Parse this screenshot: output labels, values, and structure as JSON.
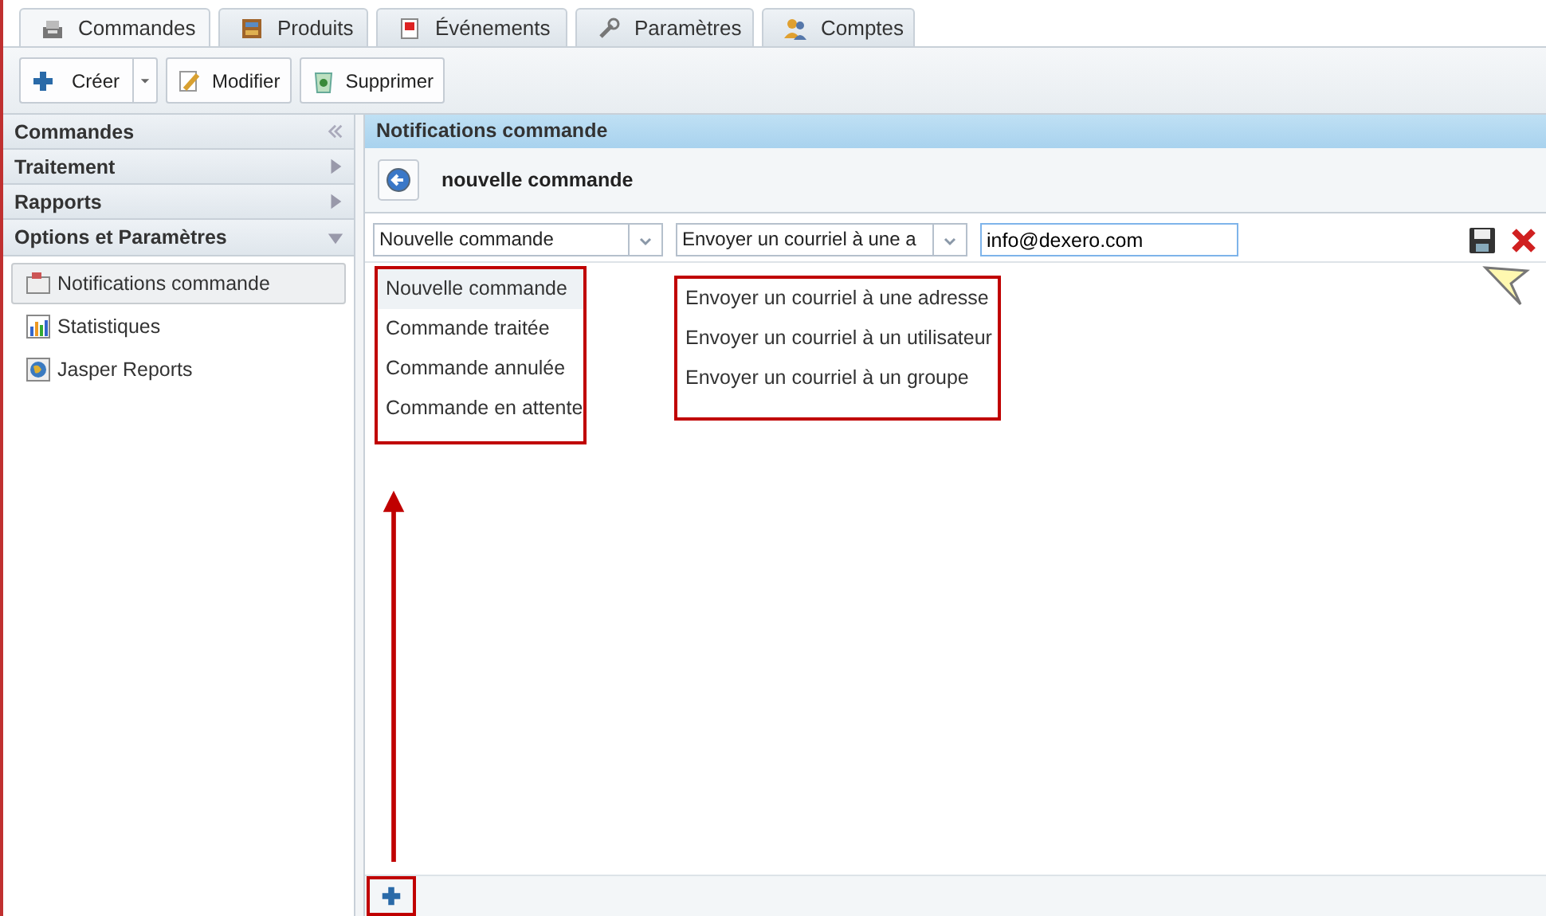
{
  "tabs": [
    {
      "label": "Commandes",
      "selected": true
    },
    {
      "label": "Produits",
      "selected": false
    },
    {
      "label": "Événements",
      "selected": false
    },
    {
      "label": "Paramètres",
      "selected": false
    },
    {
      "label": "Comptes",
      "selected": false
    }
  ],
  "toolbar": [
    {
      "label": "Créer",
      "kind": "split"
    },
    {
      "label": "Modifier",
      "kind": "plain"
    },
    {
      "label": "Supprimer",
      "kind": "plain"
    }
  ],
  "sidebar": {
    "sections": [
      {
        "title": "Commandes",
        "kind": "collapse"
      },
      {
        "title": "Traitement",
        "expanded": false,
        "kind": "toggle"
      },
      {
        "title": "Rapports",
        "expanded": false,
        "kind": "toggle"
      },
      {
        "title": "Options et Paramètres",
        "expanded": true,
        "kind": "toggle"
      }
    ],
    "items": [
      {
        "label": "Notifications commande",
        "selected": true
      },
      {
        "label": "Statistiques",
        "selected": false
      },
      {
        "label": "Jasper Reports",
        "selected": false
      }
    ]
  },
  "panel": {
    "title": "Notifications commande",
    "subtitle": "nouvelle commande",
    "event_combo": {
      "value": "Nouvelle commande",
      "options": [
        {
          "label": "Nouvelle commande",
          "selected": true
        },
        {
          "label": "Commande traitée",
          "selected": false
        },
        {
          "label": "Commande annulée",
          "selected": false
        },
        {
          "label": "Commande en attente",
          "selected": false
        }
      ]
    },
    "action_combo": {
      "value": "Envoyer un courriel à une a",
      "options": [
        {
          "label": "Envoyer un courriel à une adresse",
          "selected": false
        },
        {
          "label": "Envoyer un courriel à un utilisateur",
          "selected": false
        },
        {
          "label": "Envoyer un courriel à un groupe",
          "selected": false
        }
      ]
    },
    "email": {
      "value": "info@dexero.com"
    }
  }
}
